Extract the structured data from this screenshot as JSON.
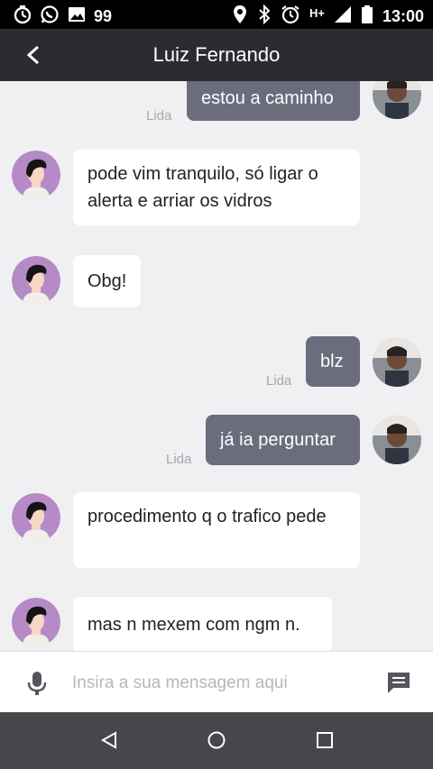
{
  "status_bar": {
    "notification_count": "99",
    "network": "H+",
    "time": "13:00",
    "icons": [
      "timer-icon",
      "whatsapp-icon",
      "gallery-icon",
      "location-icon",
      "bluetooth-icon",
      "alarm-icon",
      "signal-icon",
      "battery-icon"
    ]
  },
  "header": {
    "title": "Luiz Fernando",
    "back_icon": "chevron-left-icon"
  },
  "messages": [
    {
      "direction": "outgoing",
      "text": "estou a caminho",
      "status": "Lida"
    },
    {
      "direction": "incoming",
      "text": "pode vim tranquilo, só ligar o alerta e arriar os vidros"
    },
    {
      "direction": "incoming",
      "text": "Obg!"
    },
    {
      "direction": "outgoing",
      "text": "blz",
      "status": "Lida"
    },
    {
      "direction": "outgoing",
      "text": "já ia perguntar",
      "status": "Lida"
    },
    {
      "direction": "incoming",
      "text": "procedimento q o trafico pede"
    },
    {
      "direction": "incoming",
      "text": "mas n mexem com ngm n."
    }
  ],
  "composer": {
    "placeholder": "Insira a sua mensagem aqui",
    "mic_icon": "microphone-icon",
    "send_icon": "message-icon"
  },
  "nav_bar": {
    "icons": [
      "back-triangle-icon",
      "home-circle-icon",
      "recents-square-icon"
    ]
  },
  "colors": {
    "status_bar": "#000000",
    "header": "#2b2c30",
    "background": "#f0f0f2",
    "outgoing_bubble": "#6b6d7d",
    "incoming_bubble": "#ffffff",
    "incoming_avatar": "#b58ac7",
    "nav_bar": "#45474a"
  }
}
